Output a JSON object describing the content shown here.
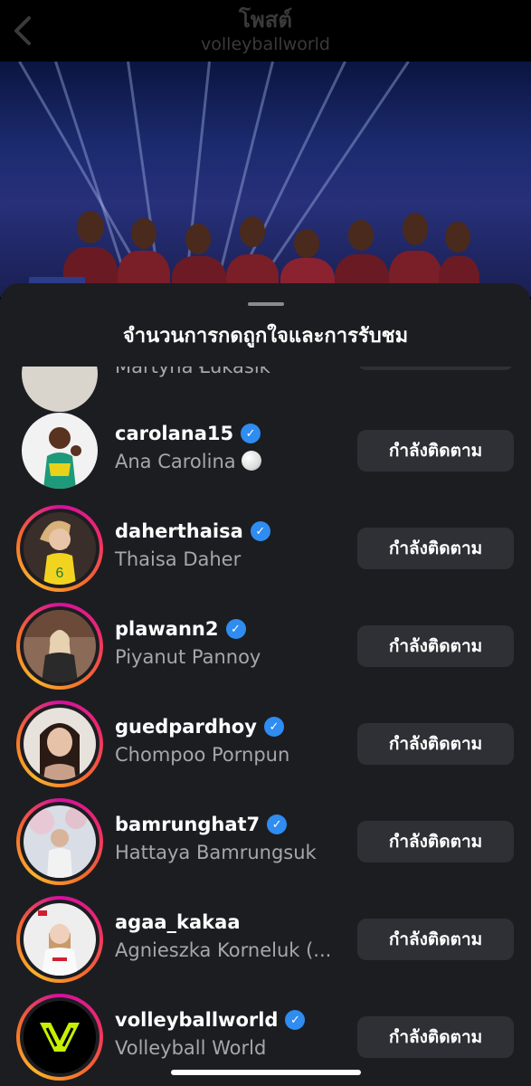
{
  "header": {
    "title": "โพสต์",
    "subtitle": "volleyballworld"
  },
  "sheet": {
    "title": "จำนวนการกดถูกใจและการรับชม"
  },
  "partial_row": {
    "fullname": "Martyna Łukasik"
  },
  "users": [
    {
      "username": "carolana15",
      "fullname": "Ana Carolina",
      "verified": true,
      "story_ring": false,
      "emoji": "volleyball",
      "button": "กำลังติดตาม"
    },
    {
      "username": "daherthaisa",
      "fullname": "Thaisa Daher",
      "verified": true,
      "story_ring": true,
      "button": "กำลังติดตาม"
    },
    {
      "username": "plawann2",
      "fullname": "Piyanut Pannoy",
      "verified": true,
      "story_ring": true,
      "button": "กำลังติดตาม"
    },
    {
      "username": "guedpardhoy",
      "fullname": "Chompoo Pornpun",
      "verified": true,
      "story_ring": true,
      "button": "กำลังติดตาม"
    },
    {
      "username": "bamrunghat7",
      "fullname": "Hattaya Bamrungsuk",
      "verified": true,
      "story_ring": true,
      "button": "กำลังติดตาม"
    },
    {
      "username": "agaa_kakaa",
      "fullname": "Agnieszka Korneluk (...",
      "verified": false,
      "story_ring": true,
      "button": "กำลังติดตาม"
    },
    {
      "username": "volleyballworld",
      "fullname": "Volleyball World",
      "verified": true,
      "story_ring": true,
      "button": "กำลังติดตาม"
    }
  ],
  "colors": {
    "accent_verified": "#2f8cf0",
    "sheet_bg": "#1c1d21",
    "button_bg": "#2e3035",
    "brand_logo": "#c6f000"
  }
}
